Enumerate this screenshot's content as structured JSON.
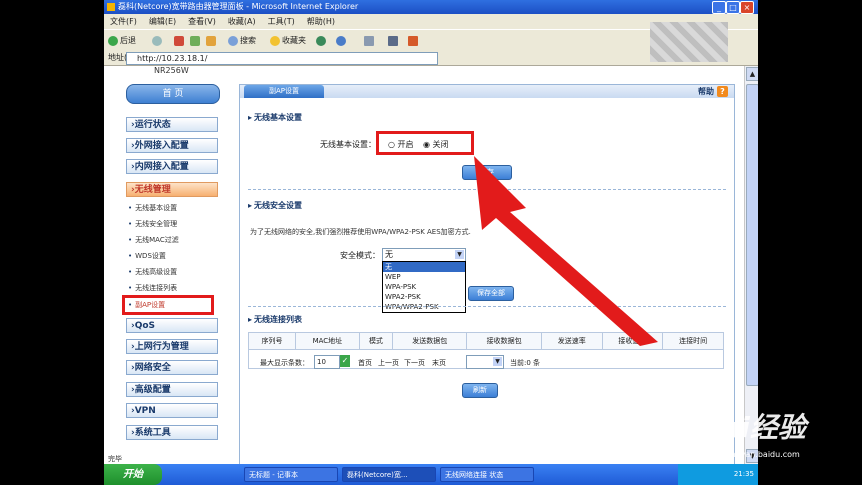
{
  "window": {
    "title": "磊科(Netcore)宽带路由器管理面板 - Microsoft Internet Explorer",
    "min": "_",
    "max": "□",
    "close": "×"
  },
  "menu": [
    "文件(F)",
    "编辑(E)",
    "查看(V)",
    "收藏(A)",
    "工具(T)",
    "帮助(H)"
  ],
  "toolbar": {
    "back": "后退",
    "search": "搜索",
    "favorites": "收藏夹"
  },
  "address": {
    "label": "地址(D)",
    "url": "http://10.23.18.1/"
  },
  "brand": "NR256W",
  "sidebar": {
    "home": "首 页",
    "items": [
      "›运行状态",
      "›外网接入配置",
      "›内网接入配置",
      "›无线管理"
    ],
    "subitems": [
      "无线基本设置",
      "无线安全管理",
      "无线MAC过滤",
      "WDS设置",
      "无线高级设置",
      "无线连接列表",
      "副AP设置"
    ],
    "items2": [
      "›QoS",
      "›上网行为管理",
      "›网络安全",
      "›高级配置",
      "›VPN",
      "›系统工具"
    ]
  },
  "panel": {
    "tab": "副AP设置",
    "help": "帮助",
    "help_icon": "?",
    "basic": {
      "title": "无线基本设置",
      "label": "无线基本设置：",
      "on": "开启",
      "off": "关闭",
      "save": "保存"
    },
    "security": {
      "title": "无线安全设置",
      "note": "为了无线网络的安全,我们强烈推荐使用WPA/WPA2-PSK AES加密方式.",
      "mode_label": "安全模式：",
      "selected": "无",
      "options": [
        "无",
        "WEP",
        "WPA-PSK",
        "WPA2-PSK",
        "WPA/WPA2-PSK"
      ],
      "save": "保存全部"
    },
    "connections": {
      "title": "无线连接列表",
      "columns": [
        "序列号",
        "MAC地址",
        "模式",
        "发送数据包",
        "接收数据包",
        "发送速率",
        "接收速率",
        "连接时间"
      ],
      "max_label": "最大显示条数：",
      "max_value": "10",
      "first": "首页",
      "prev": "上一页",
      "next": "下一页",
      "last": "末页",
      "current": "当前:0 条",
      "refresh": "刷新"
    }
  },
  "statusbar": "完毕",
  "taskbar": {
    "start": "开始",
    "tasks": [
      "无标题 - 记事本",
      "磊科(Netcore)宽...",
      "无线网络连接 状态"
    ],
    "clock": "21:35"
  },
  "watermark": {
    "logo": "Bai经验",
    "url": "jingyan.baidu.com"
  }
}
